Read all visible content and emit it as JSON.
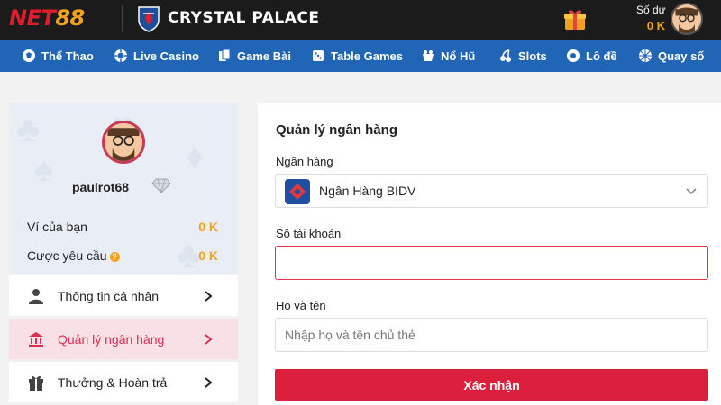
{
  "header": {
    "brand_net": "NET",
    "brand_num": "88",
    "partner": "CRYSTAL PALACE",
    "balance_label": "Số dư",
    "balance_value": "0 K"
  },
  "nav": {
    "items": [
      {
        "label": "Thể Thao",
        "icon": "soccer-ball-icon"
      },
      {
        "label": "Live Casino",
        "icon": "casino-chip-icon"
      },
      {
        "label": "Game Bài",
        "icon": "playing-cards-icon"
      },
      {
        "label": "Table Games",
        "icon": "dice-icon"
      },
      {
        "label": "Nổ Hũ",
        "icon": "jackpot-icon"
      },
      {
        "label": "Slots",
        "icon": "cherries-icon"
      },
      {
        "label": "Lô đề",
        "icon": "lottery-ball-icon"
      },
      {
        "label": "Quay số",
        "icon": "spin-wheel-icon"
      }
    ]
  },
  "profile": {
    "username": "paulrot68",
    "wallet_label": "Ví của bạn",
    "wallet_value": "0 K",
    "wager_label": "Cược yêu cầu",
    "wager_value": "0 K"
  },
  "menu": {
    "items": [
      {
        "label": "Thông tin cá nhân",
        "icon": "user-icon",
        "active": false
      },
      {
        "label": "Quản lý ngân hàng",
        "icon": "bank-icon",
        "active": true
      },
      {
        "label": "Thưởng & Hoàn trả",
        "icon": "gift-box-icon",
        "active": false
      }
    ]
  },
  "form": {
    "title": "Quản lý ngân hàng",
    "bank_label": "Ngân hàng",
    "bank_value": "Ngân Hàng BIDV",
    "account_label": "Số tài khoản",
    "account_value": "",
    "name_label": "Họ và tên",
    "name_placeholder": "Nhập họ và tên chủ thẻ",
    "submit_label": "Xác nhận"
  },
  "colors": {
    "brand_red": "#e01e2b",
    "brand_gold": "#f3a21b",
    "nav_blue": "#2065b6",
    "active_pink": "#f9e0e6",
    "confirm_red": "#dc1f3c"
  }
}
